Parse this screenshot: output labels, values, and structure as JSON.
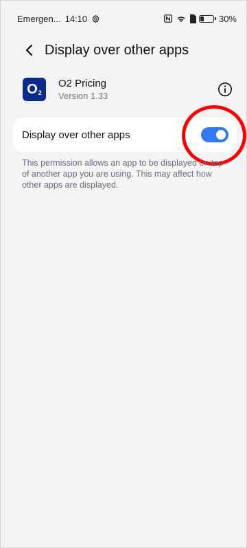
{
  "status_bar": {
    "carrier": "Emergen...",
    "time": "14:10",
    "battery_percent": "30%",
    "battery_level": 0.3,
    "icons": [
      "settings-gear-icon",
      "nfc-icon",
      "wifi-icon",
      "sim-icon",
      "battery-icon"
    ]
  },
  "header": {
    "title": "Display over other apps"
  },
  "app": {
    "name": "O2 Pricing",
    "version": "Version 1.33",
    "icon_letter": "O",
    "icon_sub": "2",
    "icon_color": "#0a2a8c"
  },
  "setting": {
    "label": "Display over other apps",
    "enabled": true,
    "toggle_color": "#3478f6"
  },
  "description": "This permission allows an app to be displayed on top of another app you are using. This may affect how other apps are displayed.",
  "annotation": {
    "color": "#ff0000"
  }
}
